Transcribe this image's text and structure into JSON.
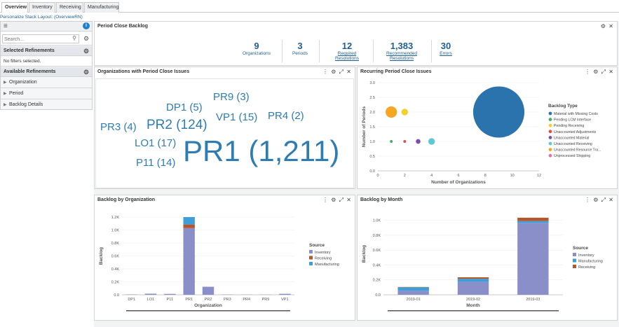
{
  "tabs": [
    "Overview",
    "Inventory",
    "Receiving",
    "Manufacturing"
  ],
  "personalize_link": "Personalize Stack Layout: (OverviewRN)",
  "left": {
    "search_placeholder": "Search...",
    "selected_refinements": "Selected Refinements",
    "no_filters": "No filters selected.",
    "available_refinements": "Available Refinements",
    "items": [
      "Organization",
      "Period",
      "Backlog Details"
    ]
  },
  "backlog": {
    "title": "Period Close Backlog",
    "metrics": [
      {
        "value": "9",
        "label": "Organizations",
        "link": false
      },
      {
        "value": "3",
        "label": "Periods",
        "link": false
      },
      {
        "value": "12",
        "label": "Required Resolutions",
        "link": true
      },
      {
        "value": "1,383",
        "label": "Recommended Resolutions",
        "link": true
      },
      {
        "value": "30",
        "label": "Errors",
        "link": true
      }
    ]
  },
  "orgs_panel": {
    "title": "Organizations with Period Close Issues",
    "words": [
      "PR9 (3)",
      "DP1 (5)",
      "PR3 (4)",
      "PR2 (124)",
      "VP1 (15)",
      "PR4 (2)",
      "LO1 (17)",
      "P11 (14)",
      "PR1 (1,211)"
    ]
  },
  "recurring_panel": {
    "title": "Recurring Period Close Issues",
    "legend_title": "Backlog Type",
    "chart_data": {
      "type": "scatter",
      "xlabel": "Number of Organizations",
      "ylabel": "Number of Periods",
      "xlim": [
        0,
        12
      ],
      "ylim": [
        0,
        3
      ],
      "xticks": [
        "0",
        "2",
        "4",
        "6",
        "8",
        "10",
        "12"
      ],
      "yticks": [
        "0.0",
        "0.5",
        "1.0",
        "1.5",
        "2.0",
        "2.5",
        "3.0"
      ],
      "series": [
        {
          "name": "Material with Missing Costs",
          "color": "#2a73ad",
          "points": [
            [
              9,
              2,
              1211
            ]
          ]
        },
        {
          "name": "Pending LCM Interface",
          "color": "#4aa86a",
          "points": [
            [
              1,
              1,
              1
            ]
          ]
        },
        {
          "name": "Pending Receiving",
          "color": "#f2d02e",
          "points": [
            [
              2,
              2,
              20
            ]
          ]
        },
        {
          "name": "Unaccounted Adjustments",
          "color": "#d9534f",
          "points": [
            [
              2,
              1,
              2
            ]
          ]
        },
        {
          "name": "Unaccounted Material",
          "color": "#7b4fb0",
          "points": [
            [
              3,
              1,
              10
            ]
          ]
        },
        {
          "name": "Unaccounted Receiving",
          "color": "#5fc9d1",
          "points": [
            [
              4,
              1,
              20
            ]
          ]
        },
        {
          "name": "Unaccounted Resource Tra...",
          "color": "#f5a623",
          "points": [
            [
              1,
              2,
              60
            ]
          ]
        },
        {
          "name": "Unprocessed Shipping",
          "color": "#e56fa5",
          "points": []
        }
      ]
    }
  },
  "org_backlog_panel": {
    "title": "Backlog by Organization",
    "legend_title": "Source",
    "chart_data": {
      "type": "bar",
      "xlabel": "Organization",
      "ylabel": "Backlog",
      "ylim": [
        0,
        1200
      ],
      "yticks": [
        "0.0",
        "0.2K",
        "0.4K",
        "0.6K",
        "0.8K",
        "1.0K",
        "1.2K"
      ],
      "categories": [
        "DP1",
        "LO1",
        "P11",
        "PR1",
        "PR2",
        "PR3",
        "PR4",
        "PR9",
        "VP1"
      ],
      "series": [
        {
          "name": "Inventory",
          "color": "#8b8fc9",
          "values": [
            5,
            17,
            14,
            1030,
            124,
            4,
            2,
            3,
            15
          ]
        },
        {
          "name": "Receiving",
          "color": "#b5562e",
          "values": [
            0,
            0,
            0,
            55,
            0,
            0,
            0,
            0,
            0
          ]
        },
        {
          "name": "Manufacturing",
          "color": "#3d9ed8",
          "values": [
            0,
            0,
            0,
            115,
            0,
            0,
            0,
            0,
            0
          ]
        }
      ]
    }
  },
  "month_backlog_panel": {
    "title": "Backlog by Month",
    "legend_title": "Source",
    "chart_data": {
      "type": "bar",
      "xlabel": "Month",
      "ylabel": "Backlog",
      "ylim": [
        0,
        1100
      ],
      "yticks": [
        "0.0",
        "0.2K",
        "0.4K",
        "0.6K",
        "0.8K",
        "1.0K"
      ],
      "categories": [
        "2019-01",
        "2019-02",
        "2019-03"
      ],
      "series": [
        {
          "name": "Inventory",
          "color": "#8b8fc9",
          "values": [
            55,
            175,
            965
          ]
        },
        {
          "name": "Manufacturing",
          "color": "#3d9ed8",
          "values": [
            45,
            40,
            25
          ]
        },
        {
          "name": "Receiving",
          "color": "#b5562e",
          "values": [
            5,
            20,
            45
          ]
        }
      ]
    }
  }
}
